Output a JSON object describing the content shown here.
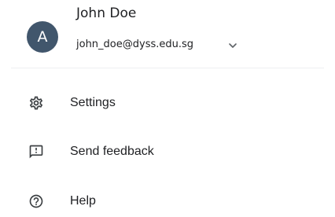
{
  "account": {
    "avatar_initial": "A",
    "name": "John Doe",
    "email": "john_doe@dyss.edu.sg",
    "expand_icon": "chevron-down-icon"
  },
  "menu": {
    "items": [
      {
        "label": "Settings",
        "icon": "gear-icon"
      },
      {
        "label": "Send feedback",
        "icon": "feedback-icon"
      },
      {
        "label": "Help",
        "icon": "help-icon"
      }
    ]
  },
  "colors": {
    "avatar_background": "#41566c",
    "text": "#202124",
    "icon": "#3c4043",
    "divider": "#eeeff1"
  }
}
